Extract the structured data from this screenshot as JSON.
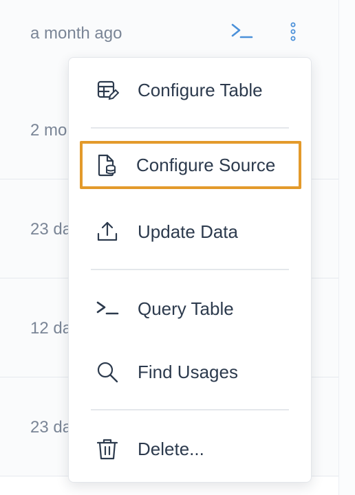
{
  "rows": [
    {
      "time": "a month ago"
    },
    {
      "time": "2 mo"
    },
    {
      "time": "23 da"
    },
    {
      "time": "12 da"
    },
    {
      "time": "23 da"
    }
  ],
  "row_actions": {
    "query_icon": "terminal-icon",
    "more_icon": "kebab-menu-icon"
  },
  "menu": {
    "items": [
      {
        "label": "Configure Table",
        "icon": "table-edit-icon"
      },
      {
        "label": "Configure Source",
        "icon": "file-database-icon",
        "highlighted": true
      },
      {
        "label": "Update Data",
        "icon": "upload-icon"
      },
      {
        "label": "Query Table",
        "icon": "terminal-icon"
      },
      {
        "label": "Find Usages",
        "icon": "search-icon"
      },
      {
        "label": "Delete...",
        "icon": "trash-icon"
      }
    ]
  },
  "colors": {
    "highlight_border": "#e39a2b",
    "accent_blue": "#4a90d9",
    "text_dark": "#2c3a4d",
    "text_muted": "#7a8596"
  }
}
